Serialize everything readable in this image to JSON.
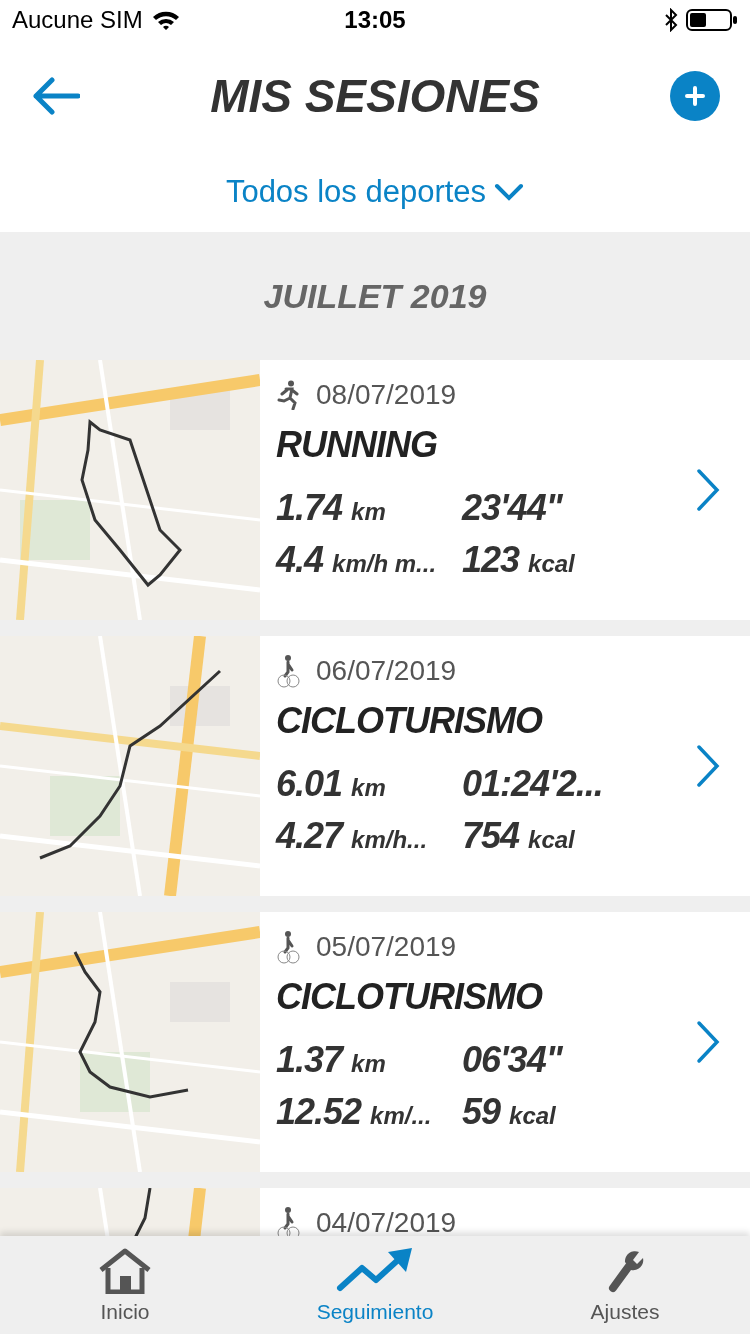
{
  "status_bar": {
    "carrier": "Aucune SIM",
    "time": "13:05"
  },
  "header": {
    "title": "MIS SESIONES"
  },
  "filter": {
    "label": "Todos los deportes"
  },
  "month": "JUILLET 2019",
  "sessions": [
    {
      "kind": "running",
      "date": "08/07/2019",
      "title": "RUNNING",
      "distance": {
        "value": "1.74",
        "unit": "km"
      },
      "duration": "23'44\"",
      "speed": {
        "value": "4.4",
        "unit": "km/h m..."
      },
      "calories": {
        "value": "123",
        "unit": "kcal"
      }
    },
    {
      "kind": "cycling",
      "date": "06/07/2019",
      "title": "CICLOTURISMO",
      "distance": {
        "value": "6.01",
        "unit": "km"
      },
      "duration": "01:24'2...",
      "speed": {
        "value": "4.27",
        "unit": "km/h..."
      },
      "calories": {
        "value": "754",
        "unit": "kcal"
      }
    },
    {
      "kind": "cycling",
      "date": "05/07/2019",
      "title": "CICLOTURISMO",
      "distance": {
        "value": "1.37",
        "unit": "km"
      },
      "duration": "06'34\"",
      "speed": {
        "value": "12.52",
        "unit": "km/..."
      },
      "calories": {
        "value": "59",
        "unit": "kcal"
      }
    },
    {
      "kind": "cycling",
      "date": "04/07/2019"
    }
  ],
  "tabs": [
    {
      "kind": "home",
      "label": "Inicio",
      "selected": false
    },
    {
      "kind": "tracking",
      "label": "Seguimiento",
      "selected": true
    },
    {
      "kind": "settings",
      "label": "Ajustes",
      "selected": false
    }
  ]
}
